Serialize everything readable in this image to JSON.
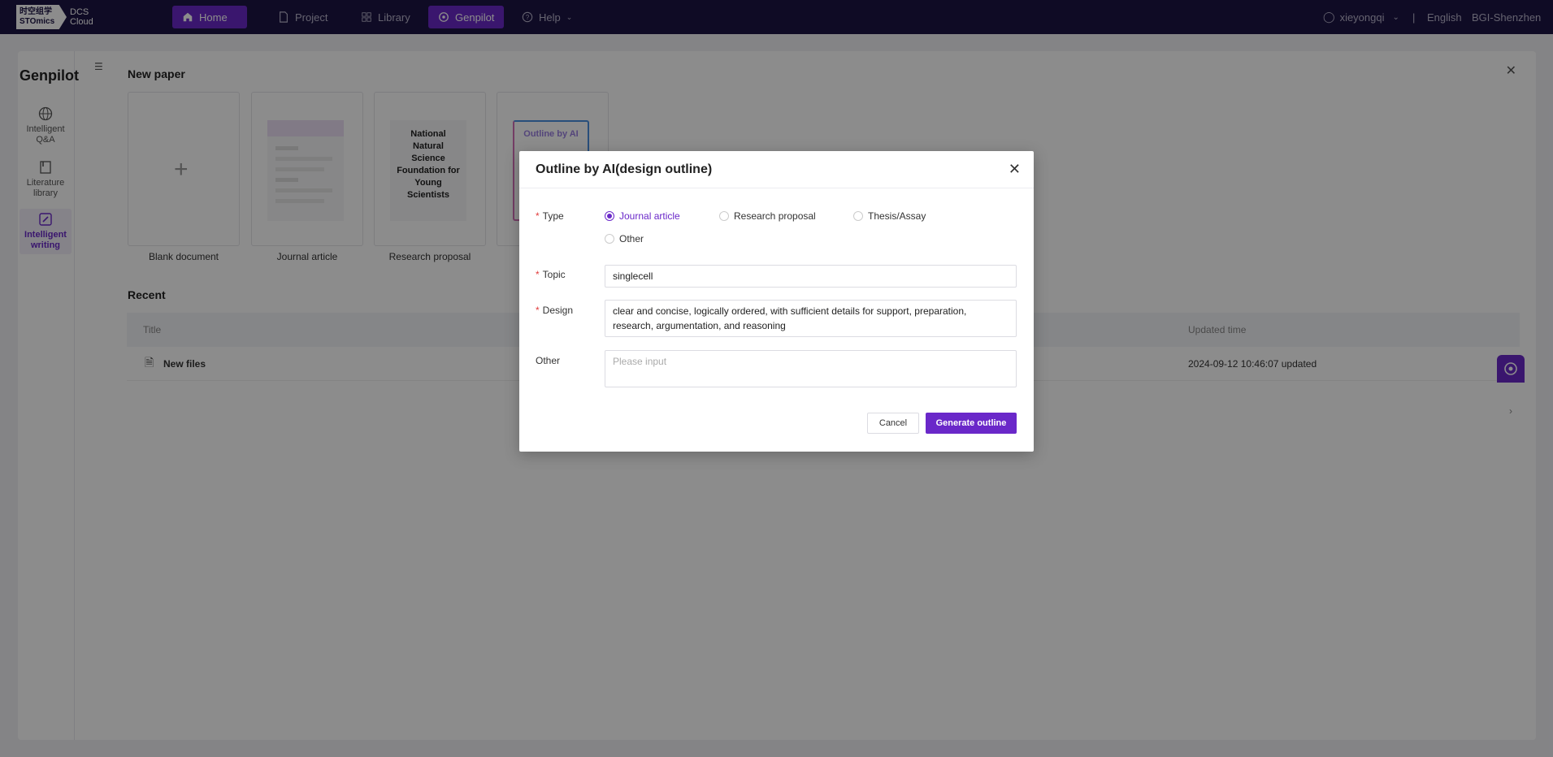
{
  "topnav": {
    "logo_cn": "时空组学",
    "logo_en": "STOmics",
    "logo_product_1": "DCS",
    "logo_product_2": "Cloud",
    "items": [
      {
        "label": "Home",
        "icon": "home-icon",
        "active": true
      },
      {
        "label": "Project",
        "icon": "file-icon",
        "active": false
      },
      {
        "label": "Library",
        "icon": "grid-icon",
        "active": false
      },
      {
        "label": "Genpilot",
        "icon": "genpilot-icon",
        "active": true
      },
      {
        "label": "Help",
        "icon": "help-icon",
        "active": false
      }
    ],
    "user": "xieyongqi",
    "language": "English",
    "region": "BGI-Shenzhen"
  },
  "sidebar": {
    "brand": "Genpilot",
    "items": [
      {
        "line1": "Intelligent",
        "line2": "Q&A",
        "icon": "globe-icon"
      },
      {
        "line1": "Literature",
        "line2": "library",
        "icon": "book-icon"
      },
      {
        "line1": "Intelligent",
        "line2": "writing",
        "icon": "edit-icon",
        "active": true
      }
    ]
  },
  "new_paper": {
    "title": "New paper",
    "templates": [
      {
        "label": "Blank document"
      },
      {
        "label": "Journal article"
      },
      {
        "label": "Research proposal",
        "thumb_text": "National Natural Science Foundation for Young Scientists"
      },
      {
        "label": "",
        "thumb_text": "Outline by AI"
      }
    ]
  },
  "recent": {
    "title": "Recent",
    "columns": [
      "Title",
      "Updated time"
    ],
    "rows": [
      {
        "title": "New files",
        "updated": "2024-09-12 10:46:07 updated"
      }
    ]
  },
  "modal": {
    "title": "Outline by AI(design outline)",
    "type_label": "Type",
    "type_options": [
      {
        "label": "Journal article",
        "checked": true
      },
      {
        "label": "Research proposal",
        "checked": false
      },
      {
        "label": "Thesis/Assay",
        "checked": false
      },
      {
        "label": "Other",
        "checked": false
      }
    ],
    "topic_label": "Topic",
    "topic_value": "singlecell",
    "design_label": "Design",
    "design_value": "clear and concise, logically ordered, with sufficient details for support, preparation, research, argumentation, and reasoning",
    "other_label": "Other",
    "other_placeholder": "Please input",
    "cancel_label": "Cancel",
    "generate_label": "Generate outline"
  },
  "colors": {
    "accent": "#6a28c9",
    "nav_bg": "#1c1444",
    "required": "#e13c3c"
  }
}
